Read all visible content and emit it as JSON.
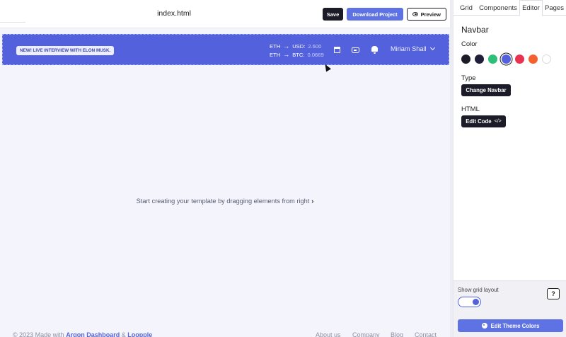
{
  "toolbar": {
    "title": "index.html",
    "save_label": "Save",
    "download_label": "Download Project",
    "preview_label": "Preview"
  },
  "navbar_preview": {
    "badge": "NEW! LIVE INTERVIEW WITH ELON MUSK.",
    "rates": [
      {
        "from": "ETH",
        "to": "USD:",
        "value": "2.600"
      },
      {
        "from": "ETH",
        "to": "BTC:",
        "value": "0.0669"
      }
    ],
    "icons": [
      "calendar-icon",
      "inbox-icon",
      "bell-icon"
    ],
    "user_name": "Miriam Shall",
    "background_color": "#5362dc"
  },
  "canvas": {
    "hint": "Start creating your template by dragging elements from right",
    "footer": {
      "copyright_prefix": "© 2023 Made with",
      "link1": "Argon Dashboard",
      "amp": "&",
      "link2": "Loopple",
      "links": [
        "About us",
        "Company",
        "Blog",
        "Contact"
      ]
    }
  },
  "panel": {
    "tabs": [
      "Grid",
      "Components",
      "Editor",
      "Pages"
    ],
    "active_tab": "Editor",
    "title": "Navbar",
    "color_label": "Color",
    "colors": [
      "#1c1c28",
      "#1f1f3a",
      "#2dbf78",
      "#5362dc",
      "#e8324f",
      "#f4612f",
      "#ffffff"
    ],
    "selected_color": "#5362dc",
    "type_label": "Type",
    "change_navbar_label": "Change Navbar",
    "html_label": "HTML",
    "edit_code_label": "Edit Code",
    "show_grid_label": "Show grid layout",
    "show_grid_enabled": true,
    "help_label": "?",
    "edit_theme_label": "Edit Theme Colors"
  }
}
